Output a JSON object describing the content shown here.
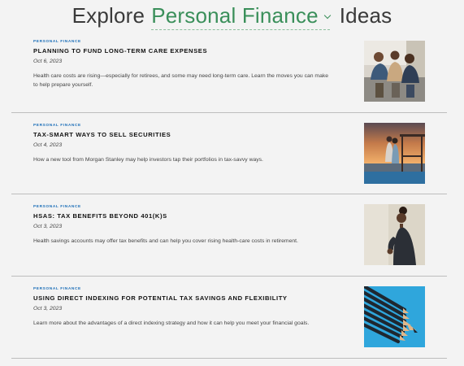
{
  "header": {
    "prefix": "Explore",
    "topic": "Personal Finance",
    "suffix": "Ideas"
  },
  "articles": [
    {
      "category": "PERSONAL FINANCE",
      "title": "PLANNING TO FUND LONG-TERM CARE EXPENSES",
      "date": "Oct 6, 2023",
      "description": "Health care costs are rising—especially for retirees, and some may need long-term care. Learn the moves you can make to help prepare yourself.",
      "image": "family-photo"
    },
    {
      "category": "PERSONAL FINANCE",
      "title": "TAX-SMART WAYS TO SELL SECURITIES",
      "date": "Oct 4, 2023",
      "description": "How a new tool from Morgan Stanley may help investors tap their portfolios in tax-savvy ways.",
      "image": "sunset-couple-photo"
    },
    {
      "category": "PERSONAL FINANCE",
      "title": "HSAS: TAX BENEFITS BEYOND 401(K)S",
      "date": "Oct 3, 2023",
      "description": "Health savings accounts may offer tax benefits and can help you cover rising health-care costs in retirement.",
      "image": "runner-photo"
    },
    {
      "category": "PERSONAL FINANCE",
      "title": "USING DIRECT INDEXING FOR POTENTIAL TAX SAVINGS AND FLEXIBILITY",
      "date": "Oct 3, 2023",
      "description": "Learn more about the advantages of a direct indexing strategy and how it can help you meet your financial goals.",
      "image": "pencils-photo"
    }
  ],
  "colors": {
    "topic": "#3a8f5a",
    "kicker": "#1d6fb8",
    "background": "#f3f3f3",
    "divider": "#bdbdbd"
  }
}
